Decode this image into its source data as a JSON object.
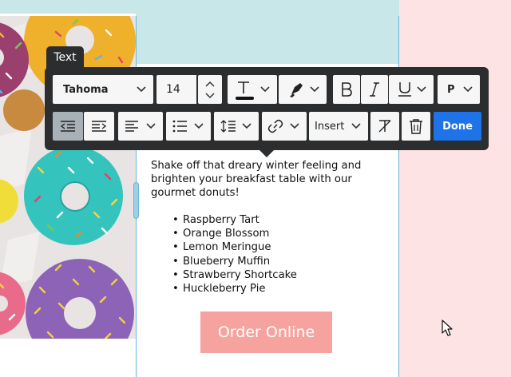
{
  "toolbar": {
    "tag_label": "Text",
    "font_family": "Tahoma",
    "font_size": "14",
    "paragraph_style": "P",
    "insert_label": "Insert",
    "done_label": "Done"
  },
  "content": {
    "intro": "Shake off that dreary winter feeling and brighten your breakfast table with our gourmet donuts!",
    "flavors": [
      "Raspberry Tart",
      "Orange Blossom",
      "Lemon Meringue",
      "Blueberry Muffin",
      "Strawberry Shortcake",
      "Huckleberry Pie"
    ],
    "cta_label": "Order Online"
  },
  "colors": {
    "accent": "#1e73e8",
    "cta": "#f6a39f",
    "page_teal": "#c8e7e8",
    "page_pink": "#fde3e3",
    "toolbar_bg": "#2b2d2f",
    "selection_outline": "#6cb3d9"
  },
  "icons": [
    "chevron-down-icon",
    "caret-up-icon",
    "caret-down-icon",
    "text-color-icon",
    "highlighter-icon",
    "bold-icon",
    "italic-icon",
    "underline-icon",
    "outdent-icon",
    "indent-icon",
    "align-left-icon",
    "bullet-list-icon",
    "line-height-icon",
    "link-icon",
    "clear-format-icon",
    "trash-icon",
    "mouse-pointer-icon"
  ]
}
